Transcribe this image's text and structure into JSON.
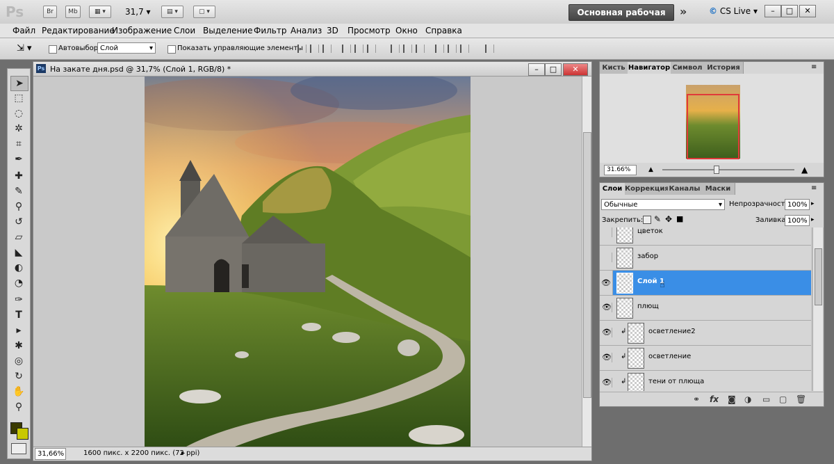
{
  "appbar": {
    "logo": "Ps",
    "br": "Br",
    "mb": "Mb",
    "zoom": "31,7",
    "workspace": "Основная рабочая среда",
    "cslive": "CS Live",
    "more": "»"
  },
  "menu": [
    "Файл",
    "Редактирование",
    "Изображение",
    "Слои",
    "Выделение",
    "Фильтр",
    "Анализ",
    "3D",
    "Просмотр",
    "Окно",
    "Справка"
  ],
  "options": {
    "autoselect_label": "Автовыбор:",
    "autoselect_value": "Слой",
    "show_controls_label": "Показать управляющие элементы"
  },
  "document": {
    "title": "На закате дня.psd @ 31,7% (Слой 1, RGB/8) *",
    "zoom": "31,66%",
    "info": "1600 пикс. x 2200 пикс. (72 ppi)"
  },
  "navigator": {
    "tabs": [
      "Кисть",
      "Навигатор",
      "Символ",
      "История"
    ],
    "zoom": "31.66%"
  },
  "layers": {
    "tabs": [
      "Слои",
      "Коррекция",
      "Каналы",
      "Маски"
    ],
    "blend_mode": "Обычные",
    "opacity_label": "Непрозрачность:",
    "opacity_value": "100%",
    "lock_label": "Закрепить:",
    "fill_label": "Заливка:",
    "fill_value": "100%",
    "items": [
      {
        "name": "цветок"
      },
      {
        "name": "забор"
      },
      {
        "name": "Слой 1"
      },
      {
        "name": "плющ"
      },
      {
        "name": "осветление2"
      },
      {
        "name": "осветление"
      },
      {
        "name": "тени от плюща"
      }
    ]
  },
  "colors": {
    "selected_layer": "#3a8ee6",
    "foreground": "#3a3a00",
    "background": "#c8c800"
  }
}
